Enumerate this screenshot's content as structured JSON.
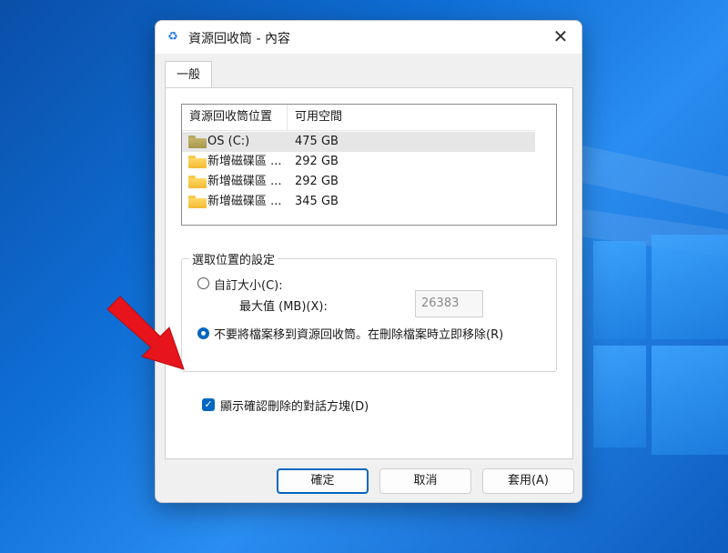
{
  "window": {
    "title": "資源回收筒 - 內容",
    "close_glyph": "✕",
    "icon_glyph": "♻"
  },
  "tabs": [
    {
      "label": "一般",
      "active": true
    }
  ],
  "list": {
    "columns": [
      "資源回收筒位置",
      "可用空間"
    ],
    "rows": [
      {
        "name": "OS (C:)",
        "space": "475 GB",
        "icon": "drive-folder-icon",
        "selected": true
      },
      {
        "name": "新增磁碟區 ...",
        "space": "292 GB",
        "icon": "folder-icon",
        "selected": false
      },
      {
        "name": "新增磁碟區 ...",
        "space": "292 GB",
        "icon": "folder-icon",
        "selected": false
      },
      {
        "name": "新增磁碟區 ...",
        "space": "345 GB",
        "icon": "folder-icon",
        "selected": false
      }
    ]
  },
  "settings": {
    "group_label": "選取位置的設定",
    "custom_size_label": "自訂大小(C):",
    "custom_size_checked": false,
    "max_size_label": "最大值 (MB)(X):",
    "max_size_value": "26383",
    "no_recycle_label": "不要將檔案移到資源回收筒。在刪除檔案時立即移除(R)",
    "no_recycle_checked": true
  },
  "confirm_delete": {
    "label": "顯示確認刪除的對話方塊(D)",
    "checked": true,
    "check_glyph": "✓"
  },
  "buttons": {
    "ok": "確定",
    "cancel": "取消",
    "apply": "套用(A)"
  },
  "colors": {
    "accent": "#0067c0",
    "annotation_arrow": "#e8141b"
  }
}
